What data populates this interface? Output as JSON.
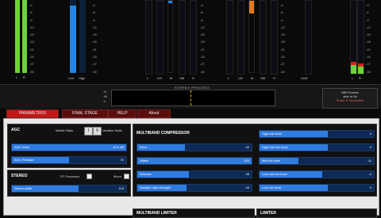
{
  "meters": {
    "agc_labels": [
      "L",
      "R"
    ],
    "live_high_labels": [
      "Live",
      "High"
    ],
    "scale_right": [
      "-3",
      "-6",
      "-9",
      "-12",
      "-15",
      "-18",
      "-21",
      "-24",
      "-27",
      "-30"
    ],
    "scale_mid": [
      "-3",
      "-6",
      "-9",
      "-12",
      "-15",
      "-18",
      "-21",
      "-24",
      "-27",
      "-30"
    ],
    "stereo_labels": [
      "L",
      "LM",
      "M",
      "HM",
      "H"
    ],
    "mb_labels": [
      "L",
      "LM",
      "M",
      "HM",
      "H"
    ],
    "limiter_labels": [
      "Limit"
    ],
    "lr_labels": [
      "L",
      "R"
    ]
  },
  "stereo_process": {
    "label": "STEREO PROCESS",
    "rows": [
      "-H",
      "-M",
      "-L"
    ],
    "mb_process": "MB Process",
    "mb_sub": "side to 0d",
    "preset": "Share & Streamline"
  },
  "tabs": [
    {
      "label": "PARAMETERS",
      "active": true
    },
    {
      "label": "FINAL STAGE",
      "active": false
    },
    {
      "label": "HELP",
      "active": false
    },
    {
      "label": "About",
      "active": false
    }
  ],
  "agc": {
    "title": "AGC",
    "infinite_ratio": "Infinite Ratio",
    "variable_ratio": "Variable Ratio",
    "btn_i": "I",
    "btn_v": "V",
    "drive": {
      "label": "AGC Drive",
      "value": "40.0 dB",
      "fraction": 1.0
    },
    "release": {
      "label": "AGC Release",
      "value": "70",
      "fraction": 0.5
    }
  },
  "stereo": {
    "title": "STEREO",
    "st_processor": "ST Processor",
    "mono": "Mono",
    "width": {
      "label": "Stereo width",
      "value": "115",
      "fraction": 0.58
    }
  },
  "mbc": {
    "title": "MULTIBAND COMPRESSOR",
    "left": [
      {
        "label": "Drive",
        "value": "42",
        "fraction": 0.42
      },
      {
        "label": "Attack",
        "value": "100",
        "fraction": 1.0
      },
      {
        "label": "Release",
        "value": "45",
        "fraction": 0.45
      },
      {
        "label": "Variable ratio strength",
        "value": "43",
        "fraction": 0.43
      }
    ],
    "right": [
      {
        "label": "High mix level",
        "value": "0",
        "fraction": 0.6
      },
      {
        "label": "High mid mix level",
        "value": "0",
        "fraction": 0.6
      },
      {
        "label": "Mid mix level",
        "value": "-11",
        "fraction": 0.34
      },
      {
        "label": "Low mid mix level",
        "value": "-2",
        "fraction": 0.55
      },
      {
        "label": "Low mix level",
        "value": "0",
        "fraction": 0.6
      }
    ]
  },
  "bottom": {
    "mb_limiter": "MULTIBAND LIMITER",
    "limiter": "LIMITER"
  },
  "colors": {
    "green": "#6bd43a",
    "blue": "#1f86e8",
    "orange": "#e07a1c",
    "red": "#d62020",
    "tab_active": "#c21818"
  }
}
